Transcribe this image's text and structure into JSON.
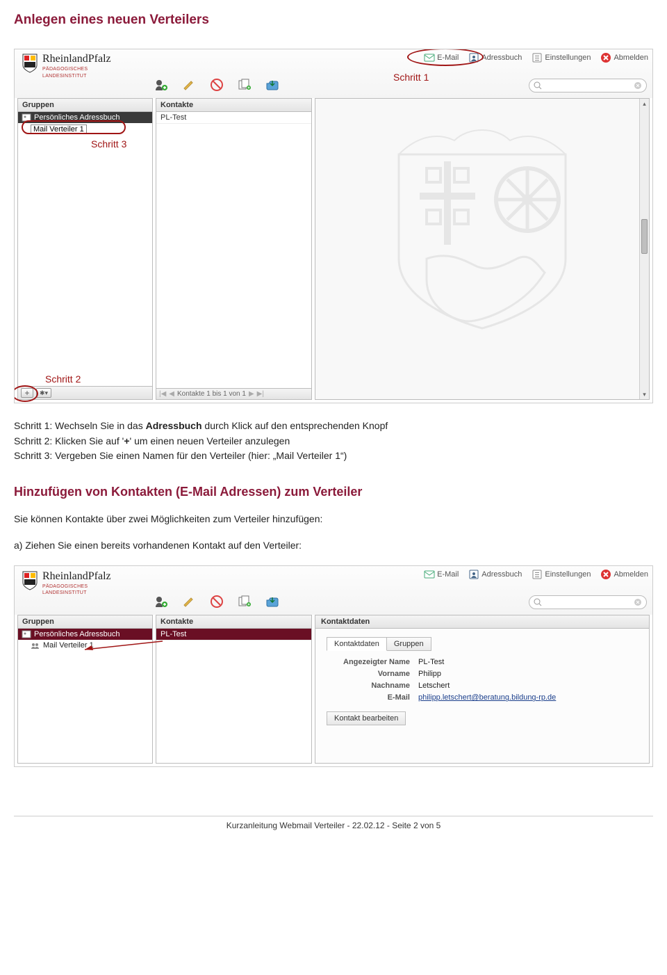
{
  "headings": {
    "h1": "Anlegen eines neuen Verteilers",
    "h2": "Hinzufügen von Kontakten (E-Mail Adressen) zum Verteiler"
  },
  "body_text": {
    "step1_prefix": "Schritt 1: Wechseln Sie in das ",
    "step1_bold": "Adressbuch",
    "step1_suffix": " durch Klick auf den entsprechenden Knopf",
    "step2_prefix": "Schritt 2: Klicken Sie auf '",
    "step2_bold": "+",
    "step2_suffix": "' um einen neuen Verteiler anzulegen",
    "step3": "Schritt 3: Vergeben Sie einen Namen für den Verteiler (hier: „Mail Verteiler 1“)",
    "intro2": "Sie können Kontakte über zwei Möglichkeiten zum Verteiler hinzufügen:",
    "option_a": "a) Ziehen Sie einen bereits vorhandenen Kontakt auf den Verteiler:"
  },
  "annotations": {
    "step1": "Schritt 1",
    "step2": "Schritt 2",
    "step3": "Schritt 3"
  },
  "app": {
    "brand": "RheinlandPfalz",
    "brand_sub1": "PÄDAGOGISCHES",
    "brand_sub2": "LANDESINSTITUT",
    "nav": {
      "email": "E-Mail",
      "addressbook": "Adressbuch",
      "settings": "Einstellungen",
      "logout": "Abmelden"
    },
    "cols": {
      "groups": "Gruppen",
      "contacts": "Kontakte",
      "details": "Kontaktdaten"
    },
    "groups": {
      "personal": "Persönliches Adressbuch",
      "verteiler1": "Mail Verteiler 1"
    },
    "contacts": {
      "pltest": "PL-Test"
    },
    "pager": "Kontakte 1 bis 1 von 1",
    "foot_add": "+",
    "foot_gear": "✱▾",
    "details_tabs": {
      "kontaktdaten": "Kontaktdaten",
      "gruppen": "Gruppen"
    },
    "details_fields": {
      "display_lbl": "Angezeigter Name",
      "display_val": "PL-Test",
      "first_lbl": "Vorname",
      "first_val": "Philipp",
      "last_lbl": "Nachname",
      "last_val": "Letschert",
      "email_lbl": "E-Mail",
      "email_val": "philipp.letschert@beratung.bildung-rp.de"
    },
    "edit_contact": "Kontakt bearbeiten"
  },
  "footer": "Kurzanleitung Webmail Verteiler  -  22.02.12 - Seite 2 von 5"
}
